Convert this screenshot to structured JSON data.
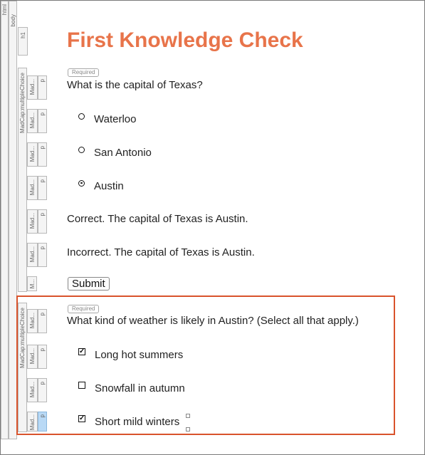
{
  "structure_bar": {
    "html_tag": "html",
    "body_tag": "body",
    "h1_tag": "h1",
    "mc1_tag": "MadCap:multipleChoice",
    "mc2_tag": "MadCap:multipleChoice",
    "mad_tag": "Mad...",
    "p_tag": "p",
    "m_tag": "M..."
  },
  "page": {
    "title": "First Knowledge Check",
    "title_color": "#e8744a"
  },
  "question1": {
    "required_label": "Required",
    "text": "What is the capital of Texas?",
    "options": [
      {
        "label": "Waterloo",
        "selected": false
      },
      {
        "label": "San Antonio",
        "selected": false
      },
      {
        "label": "Austin",
        "selected": true
      }
    ],
    "feedback_correct": "Correct. The capital of Texas is Austin.",
    "feedback_incorrect": "Incorrect. The capital of Texas is Austin.",
    "submit_label": "Submit"
  },
  "question2": {
    "required_label": "Required",
    "text": "What kind of weather is likely in Austin? (Select all that apply.)",
    "options": [
      {
        "label": "Long hot summers",
        "checked": true
      },
      {
        "label": "Snowfall in autumn",
        "checked": false
      },
      {
        "label": "Short mild winters",
        "checked": true
      }
    ],
    "check_glyph": "✓"
  },
  "colors": {
    "selection_border": "#d9532c",
    "active_tag": "#b9d9f5"
  }
}
